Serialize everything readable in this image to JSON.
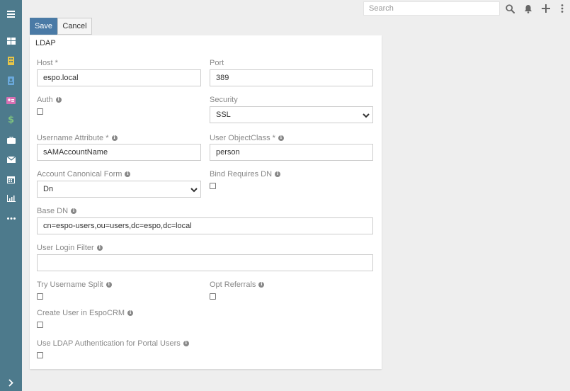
{
  "search": {
    "placeholder": "Search"
  },
  "toolbar": {
    "save_label": "Save",
    "cancel_label": "Cancel"
  },
  "panel": {
    "title": "LDAP"
  },
  "fields": {
    "host": {
      "label": "Host *",
      "value": "espo.local"
    },
    "port": {
      "label": "Port",
      "value": "389"
    },
    "auth": {
      "label": "Auth"
    },
    "security": {
      "label": "Security",
      "value": "SSL"
    },
    "username_attribute": {
      "label": "Username Attribute *",
      "value": "sAMAccountName"
    },
    "user_object_class": {
      "label": "User ObjectClass *",
      "value": "person"
    },
    "account_canonical_form": {
      "label": "Account Canonical Form",
      "value": "Dn"
    },
    "bind_requires_dn": {
      "label": "Bind Requires DN"
    },
    "base_dn": {
      "label": "Base DN",
      "value": "cn=espo-users,ou=users,dc=espo,dc=local"
    },
    "user_login_filter": {
      "label": "User Login Filter",
      "value": ""
    },
    "try_username_split": {
      "label": "Try Username Split"
    },
    "opt_referrals": {
      "label": "Opt Referrals"
    },
    "create_user": {
      "label": "Create User in EspoCRM"
    },
    "portal_auth": {
      "label": "Use LDAP Authentication for Portal Users"
    }
  },
  "icons": {
    "info_glyph": "i",
    "sidebar": [
      "menu-icon",
      "dashboard-icon",
      "building-icon",
      "contact-icon",
      "id-card-icon",
      "dollar-icon",
      "briefcase-icon",
      "envelope-icon",
      "calendar-icon",
      "chart-icon",
      "more-icon"
    ]
  },
  "colors": {
    "sidebar_bg": "#4d7a8c",
    "accent": "#4a7aa6",
    "building_icon": "#e8c547",
    "contact_icon": "#6aa9dd",
    "id_card_icon": "#d96fb3",
    "dollar_icon": "#7ec17e"
  }
}
